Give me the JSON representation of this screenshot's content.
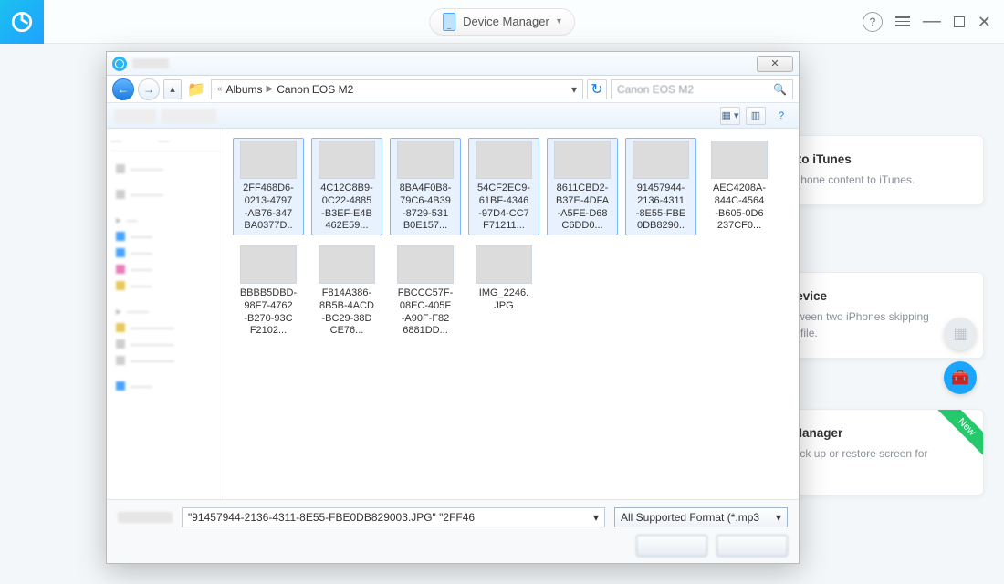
{
  "app": {
    "title": "Device Manager",
    "cards": [
      {
        "title": "Content to iTunes",
        "desc": "Transfer iPhone content to iTunes."
      },
      {
        "title": "Merge Device",
        "desc": "Merge between two iPhones skipping duplicated file."
      },
      {
        "title": "Screen Manager",
        "desc": "Design, back up or restore screen for iPhone.",
        "badge": "New"
      }
    ]
  },
  "dialog": {
    "breadcrumbs": {
      "sep_glyph": "«",
      "part1": "Albums",
      "part2": "Canon EOS M2"
    },
    "search_placeholder": "Canon EOS M2",
    "files": [
      {
        "name": "2FF468D6-0213-4797-AB76-347BA0377D...",
        "sel": true,
        "p": "p0"
      },
      {
        "name": "4C12C8B9-0C22-4885-B3EF-E4B462E59...",
        "sel": true,
        "p": "p1"
      },
      {
        "name": "8BA4F0B8-79C6-4B39-8729-531B0E157...",
        "sel": true,
        "p": "p2"
      },
      {
        "name": "54CF2EC9-61BF-4346-97D4-CC7F71211...",
        "sel": true,
        "p": "p3"
      },
      {
        "name": "8611CBD2-B37E-4DFA-A5FE-D68C6DD0...",
        "sel": true,
        "p": "p4"
      },
      {
        "name": "91457944-2136-4311-8E55-FBE0DB8290...",
        "sel": true,
        "p": "p5"
      },
      {
        "name": "AEC4208A-844C-4564-B605-0D6237CF0...",
        "sel": false,
        "p": "p6"
      },
      {
        "name": "BBBB5DBD-98F7-4762-B270-93CF2102...",
        "sel": false,
        "p": "p7"
      },
      {
        "name": "F814A386-8B5B-4ACD-BC29-38DCE76...",
        "sel": false,
        "p": "p8"
      },
      {
        "name": "FBCCC57F-08EC-405F-A90F-F826881DD...",
        "sel": false,
        "p": "p9"
      },
      {
        "name": "IMG_2246.JPG",
        "sel": false,
        "p": "p10"
      }
    ],
    "filename_value": "\"91457944-2136-4311-8E55-FBE0DB829003.JPG\" \"2FF46",
    "filter_value": "All Supported Format (*.mp3"
  }
}
